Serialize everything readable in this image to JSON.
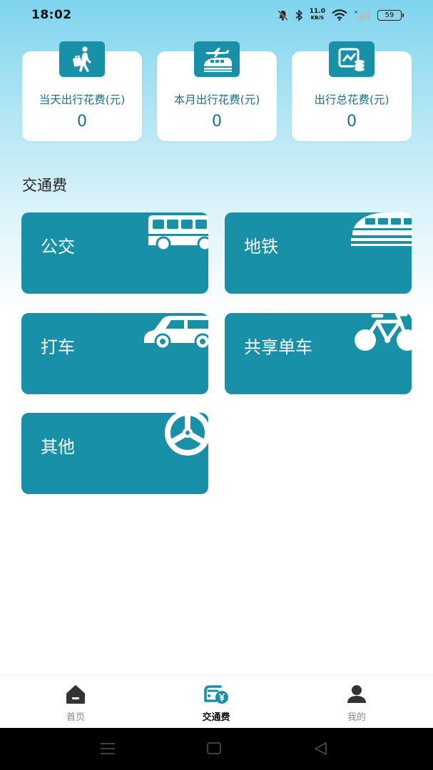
{
  "status_bar": {
    "time": "18:02",
    "net_speed_value": "11.0",
    "net_speed_unit": "KB/S",
    "battery": "59",
    "icons": [
      "mute-bell-icon",
      "bluetooth-icon",
      "wifi-icon",
      "signal-icon",
      "battery-icon"
    ]
  },
  "stats": [
    {
      "label": "当天出行花费(元)",
      "value": "0",
      "icon": "walking-traveler-icon"
    },
    {
      "label": "本月出行花费(元)",
      "value": "0",
      "icon": "train-airplane-icon"
    },
    {
      "label": "出行总花费(元)",
      "value": "0",
      "icon": "chart-coins-icon"
    }
  ],
  "section_title": "交通费",
  "categories": [
    {
      "label": "公交",
      "icon": "bus-icon"
    },
    {
      "label": "地铁",
      "icon": "subway-icon"
    },
    {
      "label": "打车",
      "icon": "taxi-icon"
    },
    {
      "label": "共享单车",
      "icon": "bicycle-icon"
    },
    {
      "label": "其他",
      "icon": "steering-wheel-icon"
    }
  ],
  "bottom_nav": [
    {
      "label": "首页",
      "icon": "home-icon",
      "active": false
    },
    {
      "label": "交通费",
      "icon": "car-fee-icon",
      "active": true
    },
    {
      "label": "我的",
      "icon": "user-icon",
      "active": false
    }
  ],
  "colors": {
    "accent": "#1890a8",
    "text_accent": "#1b6f8a",
    "nav_active": "#1890a8",
    "nav_inactive": "#333333"
  }
}
